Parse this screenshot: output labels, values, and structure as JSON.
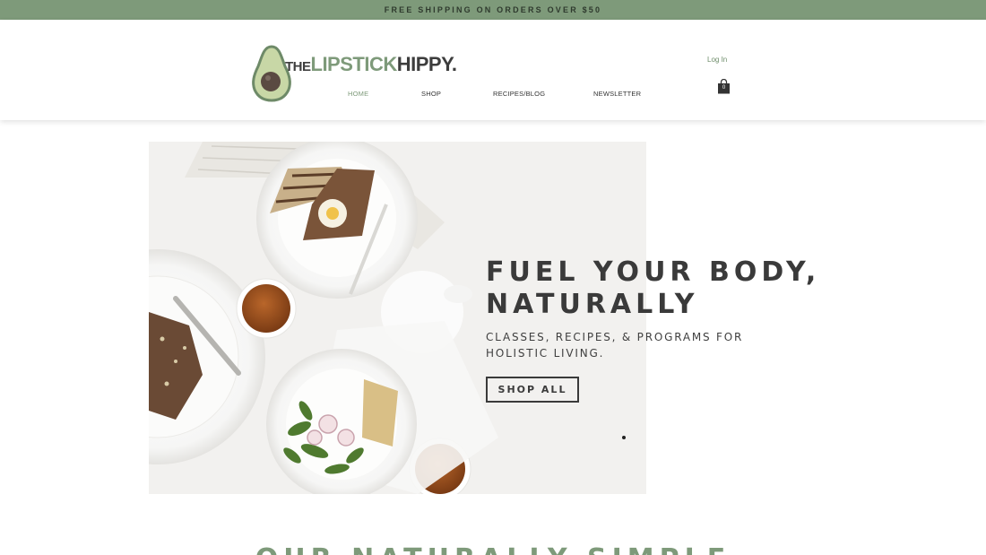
{
  "announcement": "FREE SHIPPING ON ORDERS OVER $50",
  "logo": {
    "the": "THE",
    "lipstick": "LIPSTICK",
    "hippy": "HIPPY."
  },
  "header": {
    "login_label": "Log In",
    "cart_count": "0"
  },
  "nav": [
    {
      "label": "HOME",
      "active": true
    },
    {
      "label": "SHOP"
    },
    {
      "label": "RECIPES/BLOG"
    },
    {
      "label": "NEWSLETTER"
    }
  ],
  "hero": {
    "title_line1": "FUEL YOUR BODY,",
    "title_line2": "NATURALLY",
    "subtitle": "CLASSES, RECIPES, & PROGRAMS FOR HOLISTIC LIVING.",
    "button_label": "SHOP ALL"
  },
  "section": {
    "heading": "OUR NATURALLY SIMPLE"
  },
  "colors": {
    "accent": "#7e9a7a",
    "text": "#3a3a3a",
    "announcement_bg": "#7e9a7a"
  }
}
